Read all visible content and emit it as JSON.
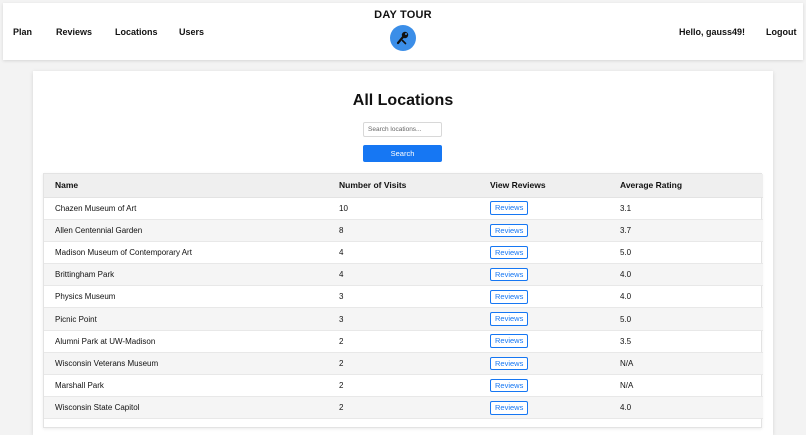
{
  "nav": {
    "links": [
      "Plan",
      "Reviews",
      "Locations",
      "Users"
    ],
    "brand": "DAY TOUR",
    "greeting": "Hello, gauss49!",
    "logout": "Logout"
  },
  "main": {
    "title": "All Locations",
    "search_placeholder": "Search locations...",
    "search_button": "Search",
    "columns": [
      "Name",
      "Number of Visits",
      "View Reviews",
      "Average Rating"
    ],
    "rows": [
      {
        "name": "Chazen Museum of Art",
        "visits": "10",
        "action": "Reviews",
        "rating": "3.1"
      },
      {
        "name": "Allen Centennial Garden",
        "visits": "8",
        "action": "Reviews",
        "rating": "3.7"
      },
      {
        "name": "Madison Museum of Contemporary Art",
        "visits": "4",
        "action": "Reviews",
        "rating": "5.0"
      },
      {
        "name": "Brittingham Park",
        "visits": "4",
        "action": "Reviews",
        "rating": "4.0"
      },
      {
        "name": "Physics Museum",
        "visits": "3",
        "action": "Reviews",
        "rating": "4.0"
      },
      {
        "name": "Picnic Point",
        "visits": "3",
        "action": "Reviews",
        "rating": "5.0"
      },
      {
        "name": "Alumni Park at UW-Madison",
        "visits": "2",
        "action": "Reviews",
        "rating": "3.5"
      },
      {
        "name": "Wisconsin Veterans Museum",
        "visits": "2",
        "action": "Reviews",
        "rating": "N/A"
      },
      {
        "name": "Marshall Park",
        "visits": "2",
        "action": "Reviews",
        "rating": "N/A"
      },
      {
        "name": "Wisconsin State Capitol",
        "visits": "2",
        "action": "Reviews",
        "rating": "4.0"
      }
    ]
  },
  "colors": {
    "accent": "#1677f3",
    "logo_bg": "#3b8ee8",
    "row_alt": "#f5f5f5",
    "header_bg": "#efefef"
  },
  "icons": {
    "logo": "tour-logo-icon"
  }
}
